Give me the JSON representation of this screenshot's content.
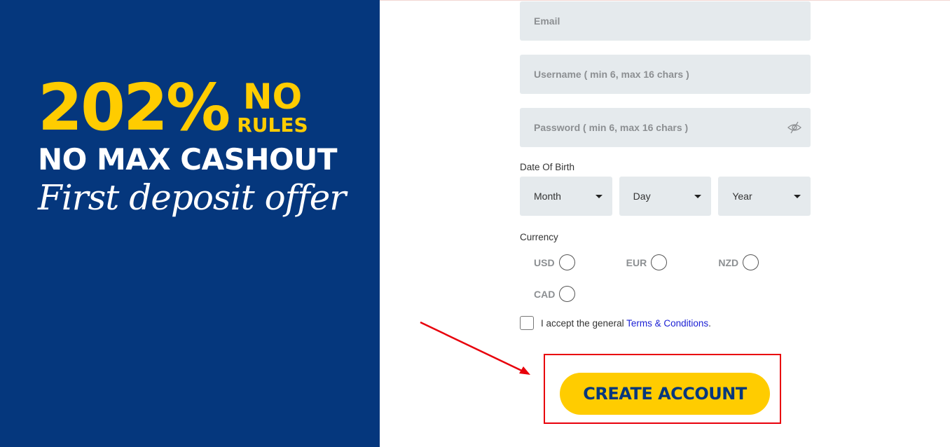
{
  "banner": {
    "headline_percent": "202%",
    "headline_side_top": "NO",
    "headline_side_bottom": "RULES",
    "line2": "NO MAX CASHOUT",
    "line3": "First deposit offer",
    "colors": {
      "background": "#05377d",
      "accent": "#ffcc00",
      "text": "#ffffff"
    }
  },
  "form": {
    "email": {
      "placeholder": "Email",
      "value": ""
    },
    "username": {
      "placeholder": "Username ( min 6, max 16 chars )",
      "value": ""
    },
    "password": {
      "placeholder": "Password ( min 6, max 16 chars )",
      "value": "",
      "toggle_icon": "eye-slash-icon"
    },
    "dob": {
      "label": "Date Of Birth",
      "month": "Month",
      "day": "Day",
      "year": "Year"
    },
    "currency": {
      "label": "Currency",
      "options": [
        "USD",
        "EUR",
        "NZD",
        "CAD"
      ],
      "selected": null
    },
    "terms": {
      "prefix": "I accept the general ",
      "link": "Terms & Conditions",
      "suffix": ".",
      "checked": false
    },
    "submit_label": "CREATE ACCOUNT"
  },
  "annotation": {
    "arrow_color": "#e8000b",
    "box_color": "#e8000b"
  }
}
